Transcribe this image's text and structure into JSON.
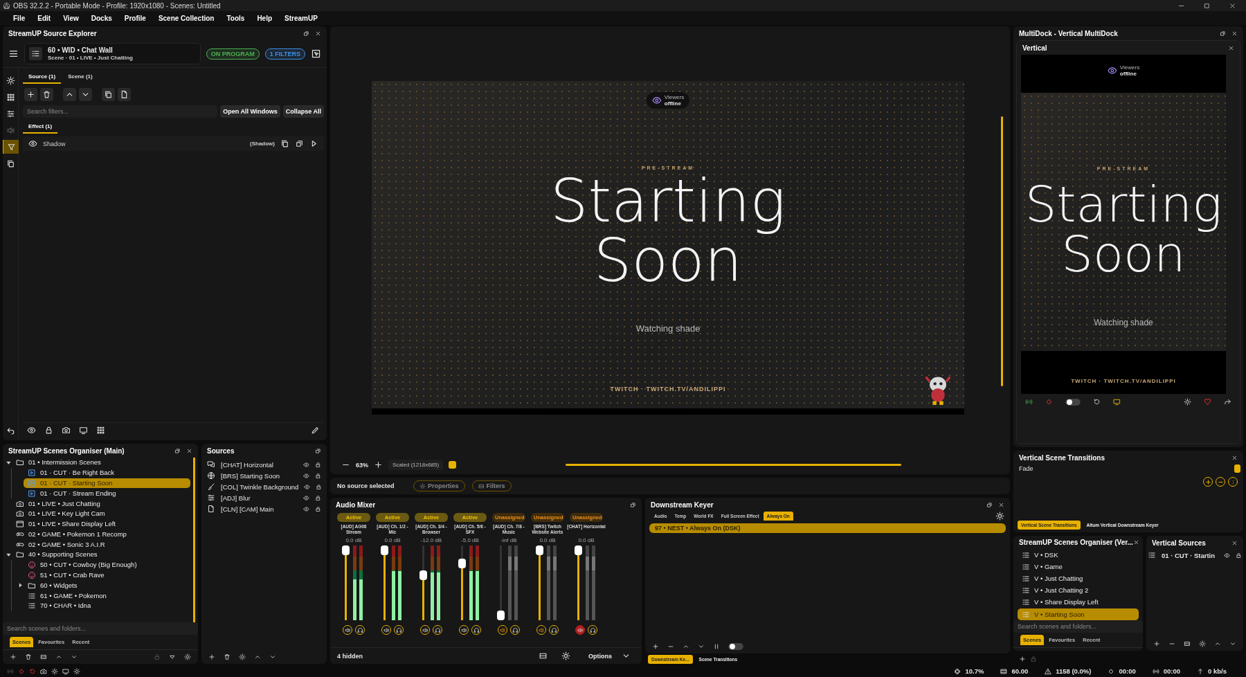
{
  "window": {
    "title": "OBS 32.2.2 - Portable Mode - Profile: 1920x1080 - Scenes: Untitled"
  },
  "menu": [
    "File",
    "Edit",
    "View",
    "Docks",
    "Profile",
    "Scene Collection",
    "Tools",
    "Help",
    "StreamUP"
  ],
  "source_explorer": {
    "title": "StreamUP Source Explorer",
    "source": {
      "name": "60 • WID • Chat Wall",
      "path": "Scene · 01 • LIVE • Just Chatting"
    },
    "badges": [
      {
        "label": "ON PROGRAM",
        "color": "#4caf50"
      },
      {
        "label": "1 FILTERS",
        "color": "#3d8fe6"
      }
    ],
    "sidebar": [
      {
        "kind": "settings",
        "selected": false,
        "disabled": false
      },
      {
        "kind": "grid",
        "selected": false,
        "disabled": false
      },
      {
        "kind": "sliders",
        "selected": false,
        "disabled": false
      },
      {
        "kind": "speaker",
        "selected": false,
        "disabled": true
      },
      {
        "kind": "funnel",
        "selected": true,
        "disabled": false
      },
      {
        "kind": "copy",
        "selected": false,
        "disabled": false
      }
    ],
    "tabs": [
      {
        "label": "Source (1)",
        "selected": true
      },
      {
        "label": "Scene (1)",
        "selected": false
      }
    ],
    "search": {
      "placeholder": "Search filters..."
    },
    "buttons": [
      "Open All Windows",
      "Collapse All"
    ],
    "groups": [
      {
        "label": "Effect (1)",
        "selected": true
      }
    ],
    "filters": [
      {
        "name": "Shadow",
        "type": "(Shadow)",
        "enabled": true
      }
    ]
  },
  "scenes": {
    "title": "StreamUP Scenes Organiser (Main)",
    "items": [
      {
        "kind": "folder",
        "name": "01 • Intermission Scenes",
        "expanded": true,
        "selected": false,
        "children": [
          {
            "kind": "media",
            "name": "01 · CUT · Be Right Back",
            "selected": false
          },
          {
            "kind": "media",
            "name": "01 · CUT · Starting Soon",
            "selected": true
          },
          {
            "kind": "media",
            "name": "01 · CUT · Stream Ending",
            "selected": false
          }
        ]
      },
      {
        "kind": "camera",
        "name": "01 • LIVE • Just Chatting",
        "selected": false
      },
      {
        "kind": "camera",
        "name": "01 • LIVE • Key Light Cam",
        "selected": false
      },
      {
        "kind": "window",
        "name": "01 • LIVE • Share Display Left",
        "selected": false
      },
      {
        "kind": "gamepad",
        "name": "02 • GAME • Pokemon 1 Recomp",
        "selected": false
      },
      {
        "kind": "gamepad",
        "name": "02 • GAME • Sonic 3 A.I.R",
        "selected": false
      },
      {
        "kind": "folder",
        "name": "40 • Supporting Scenes",
        "expanded": true,
        "selected": false,
        "children": [
          {
            "kind": "face",
            "name": "50 • CUT • Cowboy (Big Enough)",
            "selected": false
          },
          {
            "kind": "face",
            "name": "51 • CUT • Crab Rave",
            "selected": false
          },
          {
            "kind": "folder",
            "name": "60 • Widgets",
            "expanded": false,
            "selected": false
          },
          {
            "kind": "list",
            "name": "61 • GAME • Pokemon",
            "selected": false
          },
          {
            "kind": "list",
            "name": "70 • CHAR • Idna",
            "selected": false
          }
        ]
      }
    ],
    "search": {
      "placeholder": "Search scenes and folders..."
    },
    "tabs": [
      {
        "label": "Scenes",
        "selected": true
      },
      {
        "label": "Favourites",
        "selected": false
      },
      {
        "label": "Recent",
        "selected": false
      }
    ]
  },
  "sources": {
    "title": "Sources",
    "items": [
      {
        "kind": "chat",
        "name": "[CHAT] Horizontal",
        "visible": true,
        "locked": true
      },
      {
        "kind": "globe",
        "name": "[BRS] Starting Soon",
        "visible": true,
        "locked": true
      },
      {
        "kind": "brush",
        "name": "[COL] Twinkle Background",
        "visible": true,
        "locked": true
      },
      {
        "kind": "sliders",
        "name": "[ADJ] Blur",
        "visible": true,
        "locked": true
      },
      {
        "kind": "file",
        "name": "[CLN] [CAM] Main",
        "visible": true,
        "locked": true
      }
    ]
  },
  "preview": {
    "viewers_label": "Viewers",
    "viewers_status": "offline",
    "kicker": "PRE-STREAM",
    "title": "Starting Soon",
    "subtitle": "Watching shade",
    "footer": "TWITCH · TWITCH.TV/ANDILIPPI",
    "zoom": "63%",
    "scale_mode": "Scaled (1218x685)"
  },
  "selection": {
    "label": "No source selected",
    "buttons": [
      "Properties",
      "Filters"
    ]
  },
  "audio_mixer": {
    "title": "Audio Mixer",
    "channels": [
      {
        "kind": "active",
        "status": "Active",
        "name": "[AUD] AG08 Stream",
        "reading": "0.0 dB",
        "fader": {
          "level": 1
        },
        "meter": {
          "level": 0.55
        },
        "muted": false
      },
      {
        "kind": "active",
        "status": "Active",
        "name": "[AUD] Ch. 1/2 - Mic",
        "reading": "0.0 dB",
        "fader": {
          "level": 1
        },
        "meter": {
          "level": 0.66
        },
        "muted": false
      },
      {
        "kind": "active",
        "status": "Active",
        "name": "[AUD] Ch. 3/4 - Browser",
        "reading": "-12.0 dB",
        "fader": {
          "level": 0.62
        },
        "meter": {
          "level": 0.64
        },
        "muted": false
      },
      {
        "kind": "active",
        "status": "Active",
        "name": "[AUD] Ch. 5/6 - SFX",
        "reading": "-5.0 dB",
        "fader": {
          "level": 0.8
        },
        "meter": {
          "level": 0.66
        },
        "muted": false
      },
      {
        "kind": "unassigned",
        "status": "Unassigned",
        "name": "[AUD] Ch. 7/8 - Music",
        "reading": "-inf dB",
        "fader": {
          "level": 0
        },
        "meter": {
          "level": 0
        },
        "muted": false
      },
      {
        "kind": "unassigned",
        "status": "Unassigned",
        "name": "[BRS] Twitch Website Alerts",
        "reading": "0.0 dB",
        "fader": {
          "level": 1
        },
        "meter": {
          "level": 0
        },
        "muted": false
      },
      {
        "kind": "unassigned",
        "status": "Unassigned",
        "name": "[CHAT] Horizontal",
        "reading": "0.0 dB",
        "fader": {
          "level": 1
        },
        "meter": {
          "level": 0
        },
        "muted": true
      }
    ],
    "hidden": "4 hidden",
    "options": "Options"
  },
  "downstream_keyer": {
    "title": "Downstream Keyer",
    "tabs": [
      {
        "label": "Audio",
        "selected": false
      },
      {
        "label": "Temp",
        "selected": false
      },
      {
        "label": "World FX",
        "selected": false
      },
      {
        "label": "Full Screen Effect",
        "selected": false
      },
      {
        "label": "Always On",
        "selected": true
      }
    ],
    "items": [
      {
        "name": "97 • NEST • Always On (DSK)",
        "selected": true
      }
    ]
  },
  "dock_tabs": [
    {
      "label": "Downstream Ke...",
      "selected": true
    },
    {
      "label": "Scene Transitions",
      "selected": false
    }
  ],
  "multidock": {
    "title": "MultiDock - Vertical MultiDock",
    "panel_title": "Vertical",
    "preview": {
      "viewers_label": "Viewers",
      "viewers_status": "offline",
      "kicker": "PRE-STREAM",
      "title": "Starting Soon",
      "subtitle": "Watching shade",
      "footer": "TWITCH · TWITCH.TV/ANDILIPPI"
    }
  },
  "vertical_transitions": {
    "title": "Vertical Scene Transitions",
    "transition": "Fade",
    "tabs": [
      {
        "label": "Vertical Scene Transitions",
        "selected": true
      },
      {
        "label": "Aitum Vertical Downstream Keyer",
        "selected": false
      }
    ]
  },
  "vertical_scenes": {
    "title": "StreamUP Scenes Organiser (Ver...",
    "items": [
      {
        "name": "V • DSK",
        "selected": false
      },
      {
        "name": "V • Game",
        "selected": false
      },
      {
        "name": "V • Just Chatting",
        "selected": false
      },
      {
        "name": "V • Just Chatting 2",
        "selected": false
      },
      {
        "name": "V • Share Display Left",
        "selected": false
      },
      {
        "name": "V • Starting Soon",
        "selected": true
      }
    ],
    "search": {
      "placeholder": "Search scenes and folders..."
    },
    "tabs": [
      {
        "label": "Scenes",
        "selected": true
      },
      {
        "label": "Favourites",
        "selected": false
      },
      {
        "label": "Recent",
        "selected": false
      }
    ]
  },
  "vertical_sources": {
    "title": "Vertical Sources",
    "items": [
      {
        "name": "01 · CUT · Startin",
        "visible": true,
        "locked": true
      }
    ]
  },
  "status_bar": {
    "cpu": "10.7%",
    "fps": "60.00",
    "dropped": "1158 (0.0%)",
    "recording": "00:00",
    "streaming": "00:00",
    "bitrate": "0 kb/s"
  }
}
